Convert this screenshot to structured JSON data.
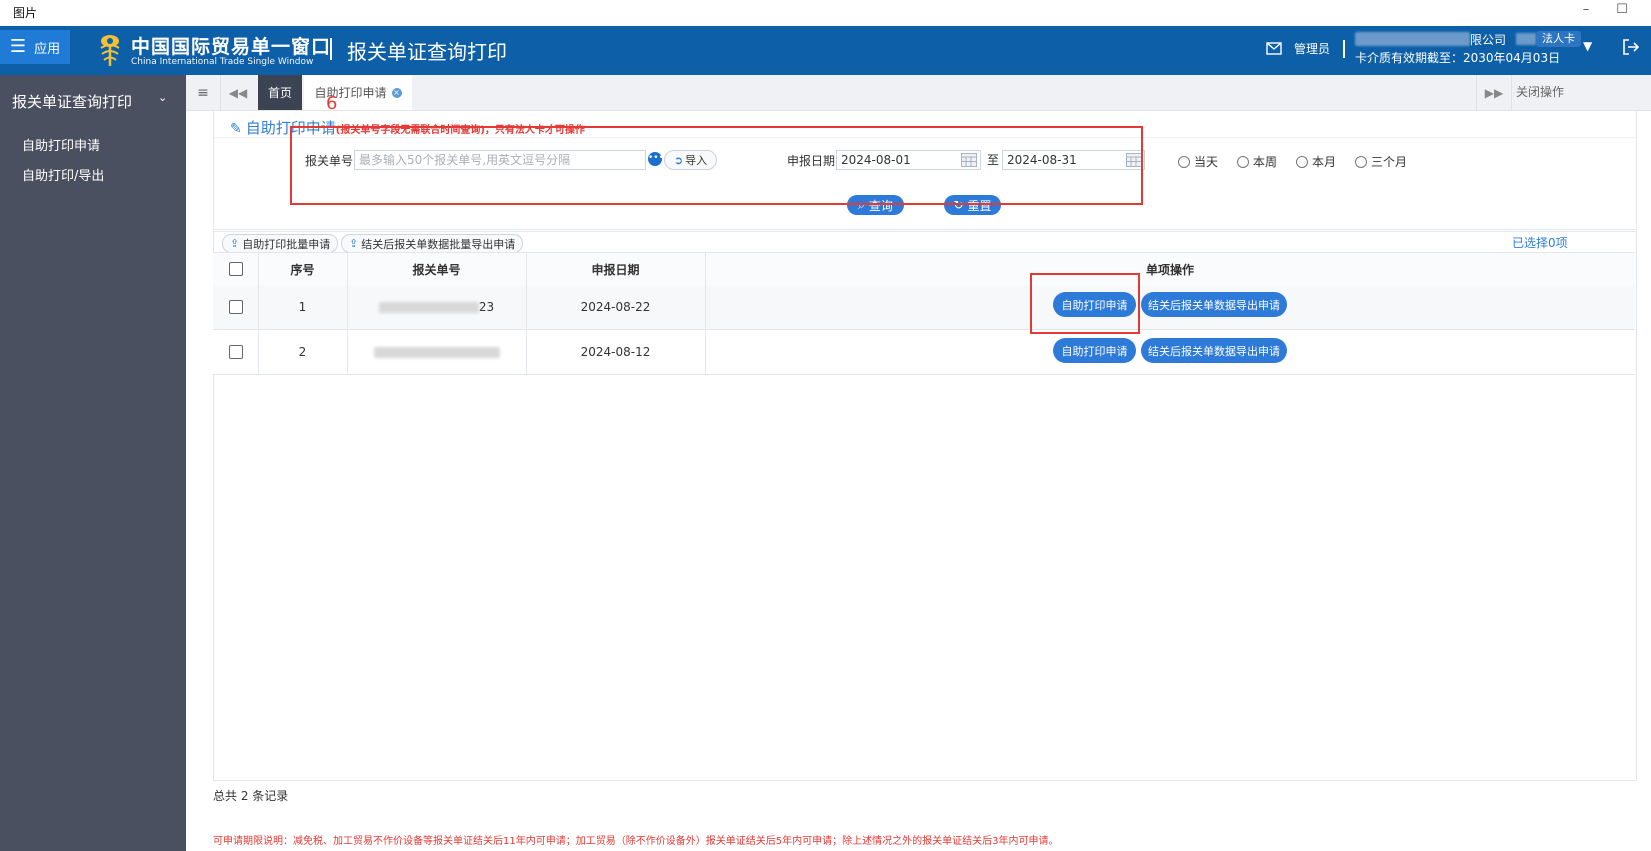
{
  "window": {
    "title": "图片",
    "minimize_glyph": "–",
    "maximize_glyph": "☐"
  },
  "header": {
    "app_label": "应用",
    "brand_cn": "中国国际贸易单一窗口",
    "brand_en": "China International Trade Single Window",
    "page_title": "报关单证查询打印",
    "admin_label": "管理员",
    "company": "限公司",
    "card_badge": "法人卡",
    "card_expiry": "卡介质有效期截至：2030年04月03日",
    "icons": [
      "menu-icon",
      "logo-icon",
      "mail-icon",
      "dropdown-icon",
      "logout-icon"
    ],
    "colors": {
      "bar": "#0d5fa8",
      "app_button": "#1f7bd6"
    }
  },
  "sidebar": {
    "heading": "报关单证查询打印",
    "items": [
      {
        "label": "自助打印申请"
      },
      {
        "label": "自助打印/导出"
      }
    ]
  },
  "tabs": {
    "home": "首页",
    "active": "自助打印申请",
    "close_ops": "关闭操作",
    "annotation": "6"
  },
  "search": {
    "title": "自助打印申请",
    "note": "(报关单号字段无需联合时间查询)，只有法人卡才可操作",
    "decl_no_label": "报关单号",
    "decl_no_placeholder": "最多输入50个报关单号,用英文逗号分隔",
    "import_label": "导入",
    "date_label": "申报日期",
    "date_from": "2024-08-01",
    "to_label": "至",
    "date_to": "2024-08-31",
    "ranges": [
      "当天",
      "本周",
      "本月",
      "三个月"
    ],
    "query_label": "查询",
    "reset_label": "重置"
  },
  "toolbar": {
    "batch_print": "自助打印批量申请",
    "batch_export": "结关后报关单数据批量导出申请",
    "selected": "已选择0项"
  },
  "table": {
    "headers": {
      "seq": "序号",
      "decl_no": "报关单号",
      "date": "申报日期",
      "ops": "单项操作"
    },
    "rows": [
      {
        "seq": "1",
        "decl_no_suffix": "23",
        "date": "2024-08-22",
        "print_btn": "自助打印申请",
        "export_btn": "结关后报关单数据导出申请"
      },
      {
        "seq": "2",
        "decl_no_suffix": "",
        "date": "2024-08-12",
        "print_btn": "自助打印申请",
        "export_btn": "结关后报关单数据导出申请"
      }
    ],
    "total": "总共 2 条记录"
  },
  "footer_note": "可申请期限说明：减免税、加工贸易不作价设备等报关单证结关后11年内可申请；加工贸易（除不作价设备外）报关单证结关后5年内可申请；除上述情况之外的报关单证结关后3年内可申请。",
  "accent": {
    "primary": "#2d7ad8",
    "annotation_red": "#e53935"
  }
}
